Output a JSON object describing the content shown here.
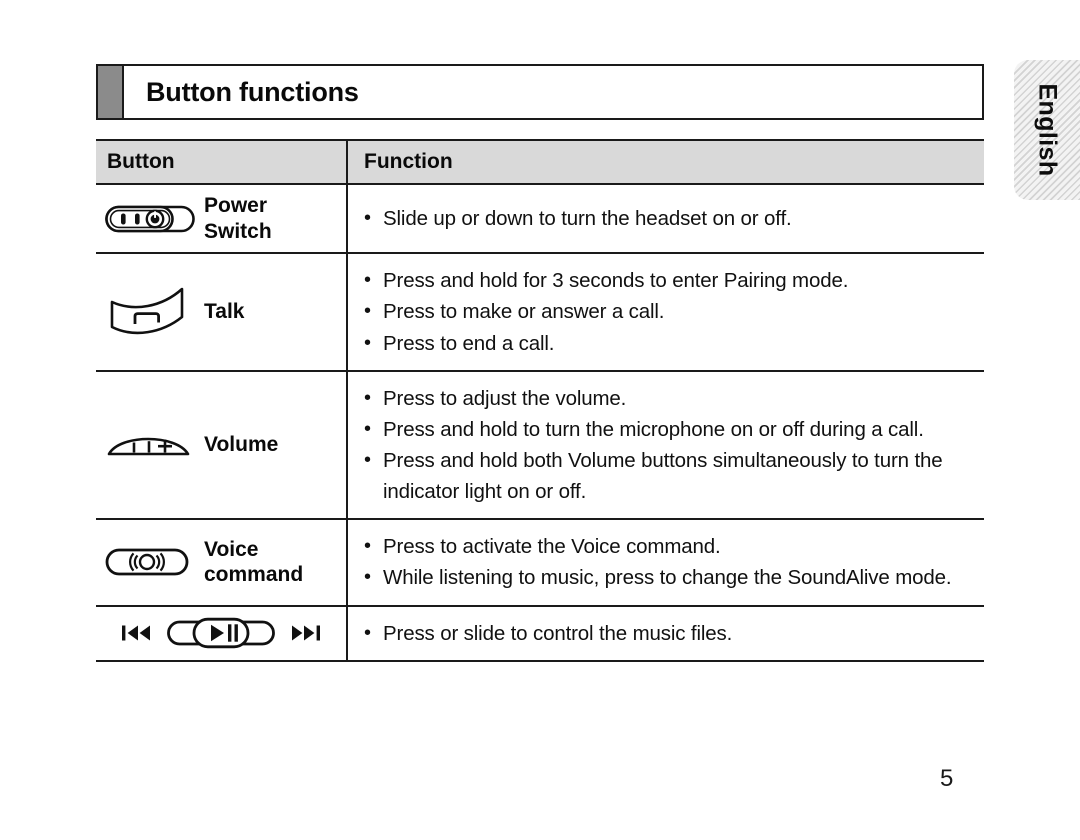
{
  "language_tab": {
    "label": "English"
  },
  "title": {
    "text": "Button functions"
  },
  "table": {
    "headers": {
      "button": "Button",
      "function": "Function"
    },
    "rows": [
      {
        "icon": "power-switch-icon",
        "label": "Power\nSwitch",
        "functions": [
          "Slide up or down to turn the headset on or off."
        ]
      },
      {
        "icon": "talk-button-icon",
        "label": "Talk",
        "functions": [
          "Press and hold for 3 seconds to enter Pairing mode.",
          "Press to make or answer a call.",
          "Press to end a call."
        ]
      },
      {
        "icon": "volume-button-icon",
        "label": "Volume",
        "functions": [
          "Press to adjust the volume.",
          "Press and hold to turn the microphone on or off during a call.",
          "Press and hold both Volume buttons simultaneously to turn the indicator light on or off."
        ]
      },
      {
        "icon": "voice-command-icon",
        "label": "Voice\ncommand",
        "functions": [
          "Press to activate the Voice command.",
          "While listening to music, press to change the SoundAlive mode."
        ]
      },
      {
        "icon": "music-controls-icon",
        "label": "",
        "functions": [
          "Press or slide to control the music files."
        ]
      }
    ]
  },
  "bullet": {
    "glyph": "•"
  },
  "page_number": "5",
  "colors": {
    "rule": "#1a1a1a",
    "header_fill": "#d9d9d9",
    "title_swatch": "#8b8b8b",
    "tab_fill": "#e9e9e9",
    "text": "#111111"
  }
}
